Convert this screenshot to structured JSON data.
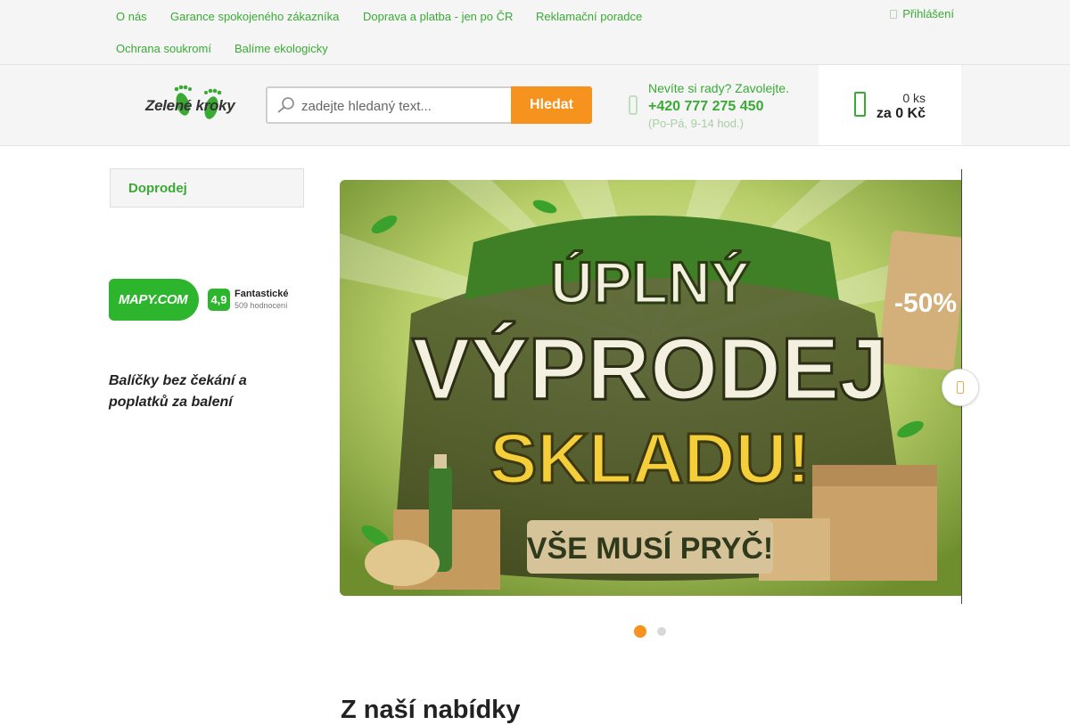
{
  "topnav": {
    "links": [
      {
        "label": "O nás"
      },
      {
        "label": "Garance spokojeného zákazníka"
      },
      {
        "label": "Doprava a platba - jen po ČR"
      },
      {
        "label": "Reklamační poradce"
      },
      {
        "label": "Ochrana soukromí"
      },
      {
        "label": "Balíme ekologicky"
      }
    ],
    "login": "Přihlášení"
  },
  "header": {
    "logo_text": "Zelené kroky",
    "search": {
      "placeholder": "zadejte hledaný text...",
      "button": "Hledat"
    },
    "contact": {
      "question": "Nevíte si rady? Zavolejte.",
      "phone": "+420 777 275 450",
      "hours": "(Po-Pá, 9-14 hod.)"
    },
    "cart": {
      "count": "0 ks",
      "price": "za 0 Kč"
    }
  },
  "sidebar": {
    "categories": [
      {
        "label": "Doprodej"
      }
    ],
    "rating": {
      "brand": "MAPY.COM",
      "score": "4,9",
      "label": "Fantastické",
      "count": "509 hodnocení"
    },
    "promo": "Balíčky bez čekání a poplatků za balení"
  },
  "banner": {
    "lines": [
      "ÚPLNÝ",
      "VÝPRODEJ",
      "SKLADU!",
      "VŠE MUSÍ PRYČ!"
    ],
    "tag": "-50%",
    "slides_total": 2,
    "active_slide": 1
  },
  "main": {
    "section_title": "Z naší nabídky"
  },
  "colors": {
    "brand_green": "#3aaa35",
    "accent_orange": "#f6921e",
    "mapy_green": "#2db52d"
  },
  "icons": [
    "user-icon",
    "search-icon",
    "phone-icon",
    "cart-icon",
    "chevron-right-icon"
  ]
}
